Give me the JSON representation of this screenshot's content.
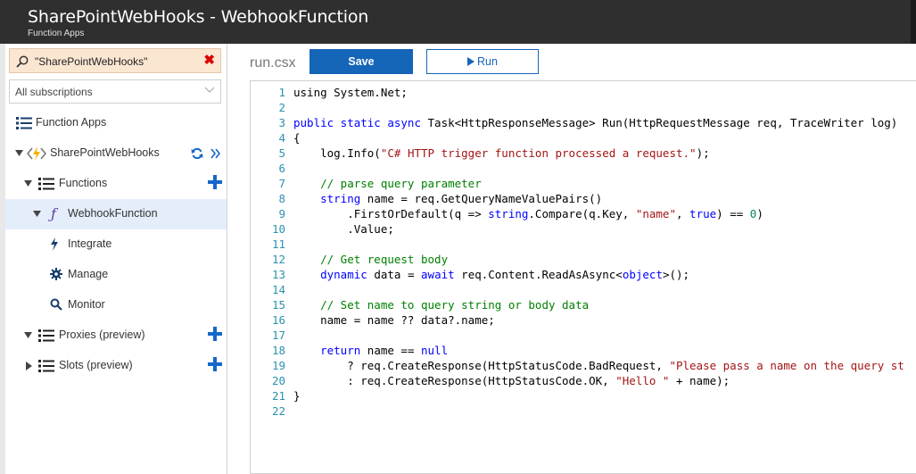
{
  "header": {
    "title": "SharePointWebHooks - WebhookFunction",
    "subtitle": "Function Apps"
  },
  "sidebar": {
    "search_value": "\"SharePointWebHooks\"",
    "subscription": "All subscriptions",
    "function_apps": "Function Apps",
    "app_name": "SharePointWebHooks",
    "functions": "Functions",
    "function_name": "WebhookFunction",
    "integrate": "Integrate",
    "manage": "Manage",
    "monitor": "Monitor",
    "proxies": "Proxies (preview)",
    "slots": "Slots (preview)"
  },
  "editor": {
    "filename": "run.csx",
    "save_label": "Save",
    "run_label": "Run",
    "lines": [
      [
        [
          "t",
          "using System.Net;"
        ]
      ],
      [],
      [
        [
          "k",
          "public static async "
        ],
        [
          "t",
          "Task<HttpResponseMessage> Run(HttpRequestMessage req, TraceWriter log)"
        ]
      ],
      [
        [
          "t",
          "{"
        ]
      ],
      [
        [
          "t",
          "    log.Info("
        ],
        [
          "s",
          "\"C# HTTP trigger function processed a request.\""
        ],
        [
          "t",
          ");"
        ]
      ],
      [],
      [
        [
          "c",
          "    // parse query parameter"
        ]
      ],
      [
        [
          "t",
          "    "
        ],
        [
          "k",
          "string"
        ],
        [
          "t",
          " name = req.GetQueryNameValuePairs()"
        ]
      ],
      [
        [
          "t",
          "        .FirstOrDefault(q => "
        ],
        [
          "k",
          "string"
        ],
        [
          "t",
          ".Compare(q.Key, "
        ],
        [
          "s",
          "\"name\""
        ],
        [
          "t",
          ", "
        ],
        [
          "k",
          "true"
        ],
        [
          "t",
          ") == "
        ],
        [
          "n",
          "0"
        ],
        [
          "t",
          ")"
        ]
      ],
      [
        [
          "t",
          "        .Value;"
        ]
      ],
      [],
      [
        [
          "c",
          "    // Get request body"
        ]
      ],
      [
        [
          "t",
          "    "
        ],
        [
          "k",
          "dynamic"
        ],
        [
          "t",
          " data = "
        ],
        [
          "k",
          "await"
        ],
        [
          "t",
          " req.Content.ReadAsAsync<"
        ],
        [
          "k",
          "object"
        ],
        [
          "t",
          ">();"
        ]
      ],
      [],
      [
        [
          "c",
          "    // Set name to query string or body data"
        ]
      ],
      [
        [
          "t",
          "    name = name ?? data?.name;"
        ]
      ],
      [],
      [
        [
          "t",
          "    "
        ],
        [
          "k",
          "return"
        ],
        [
          "t",
          " name == "
        ],
        [
          "k",
          "null"
        ]
      ],
      [
        [
          "t",
          "        ? req.CreateResponse(HttpStatusCode.BadRequest, "
        ],
        [
          "s",
          "\"Please pass a name on the query st"
        ]
      ],
      [
        [
          "t",
          "        : req.CreateResponse(HttpStatusCode.OK, "
        ],
        [
          "s",
          "\"Hello \""
        ],
        [
          "t",
          " + name);"
        ]
      ],
      [
        [
          "t",
          "}"
        ]
      ],
      []
    ]
  },
  "colors": {
    "accent": "#1565b8",
    "header_bg": "#2f2f2f",
    "search_bg": "#fbe6d2",
    "selected_bg": "#e4eefa"
  }
}
